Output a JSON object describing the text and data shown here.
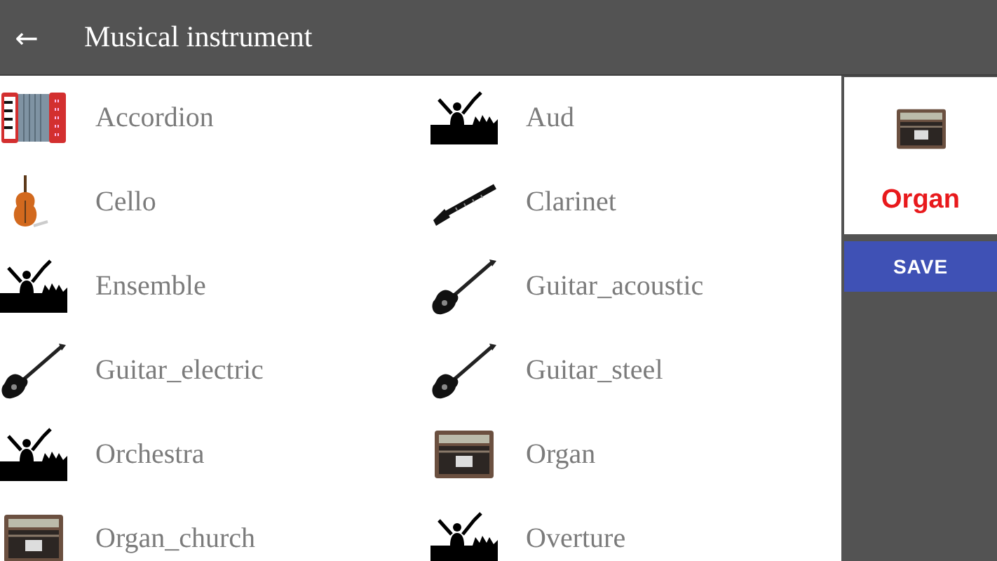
{
  "app_bar": {
    "back": "←",
    "title": "Musical instrument"
  },
  "instruments": [
    {
      "label": "Accordion",
      "kind": "accordion"
    },
    {
      "label": "Aud",
      "kind": "crowd"
    },
    {
      "label": "Cello",
      "kind": "cello"
    },
    {
      "label": "Clarinet",
      "kind": "clarinet"
    },
    {
      "label": "Ensemble",
      "kind": "crowd"
    },
    {
      "label": "Guitar_acoustic",
      "kind": "guitar"
    },
    {
      "label": "Guitar_electric",
      "kind": "guitar"
    },
    {
      "label": "Guitar_steel",
      "kind": "guitar"
    },
    {
      "label": "Orchestra",
      "kind": "crowd"
    },
    {
      "label": "Organ",
      "kind": "organ"
    },
    {
      "label": "Organ_church",
      "kind": "organ"
    },
    {
      "label": "Overture",
      "kind": "crowd"
    }
  ],
  "preview": {
    "label": "Organ",
    "kind": "organ"
  },
  "save_button": "SAVE"
}
